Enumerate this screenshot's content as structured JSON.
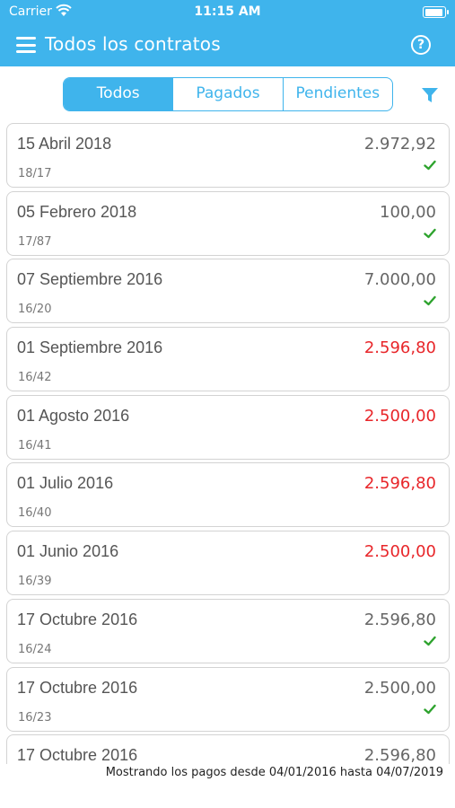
{
  "status_bar": {
    "carrier": "Carrier",
    "time": "11:15 AM"
  },
  "nav": {
    "title": "Todos los contratos",
    "menu_icon": "hamburger-menu-icon",
    "help_icon": "question-circle-icon"
  },
  "tabs": [
    {
      "label": "Todos",
      "active": true
    },
    {
      "label": "Pagados",
      "active": false
    },
    {
      "label": "Pendientes",
      "active": false
    }
  ],
  "filter_icon": "funnel-filter-icon",
  "colors": {
    "accent": "#3fb4ec",
    "pending_amount": "#e8262a",
    "paid_check": "#2ea32e"
  },
  "payments": [
    {
      "date": "15 Abril 2018",
      "ref": "18/17",
      "amount": "2.972,92",
      "paid": true
    },
    {
      "date": "05 Febrero 2018",
      "ref": "17/87",
      "amount": "100,00",
      "paid": true
    },
    {
      "date": "07 Septiembre 2016",
      "ref": "16/20",
      "amount": "7.000,00",
      "paid": true
    },
    {
      "date": "01 Septiembre 2016",
      "ref": "16/42",
      "amount": "2.596,80",
      "paid": false
    },
    {
      "date": "01 Agosto 2016",
      "ref": "16/41",
      "amount": "2.500,00",
      "paid": false
    },
    {
      "date": "01 Julio 2016",
      "ref": "16/40",
      "amount": "2.596,80",
      "paid": false
    },
    {
      "date": "01 Junio 2016",
      "ref": "16/39",
      "amount": "2.500,00",
      "paid": false
    },
    {
      "date": "17 Octubre 2016",
      "ref": "16/24",
      "amount": "2.596,80",
      "paid": true
    },
    {
      "date": "17 Octubre 2016",
      "ref": "16/23",
      "amount": "2.500,00",
      "paid": true
    },
    {
      "date": "17 Octubre 2016",
      "ref": "",
      "amount": "2.596,80",
      "paid": true
    }
  ],
  "footer": {
    "text": "Mostrando los pagos desde 04/01/2016 hasta 04/07/2019"
  }
}
